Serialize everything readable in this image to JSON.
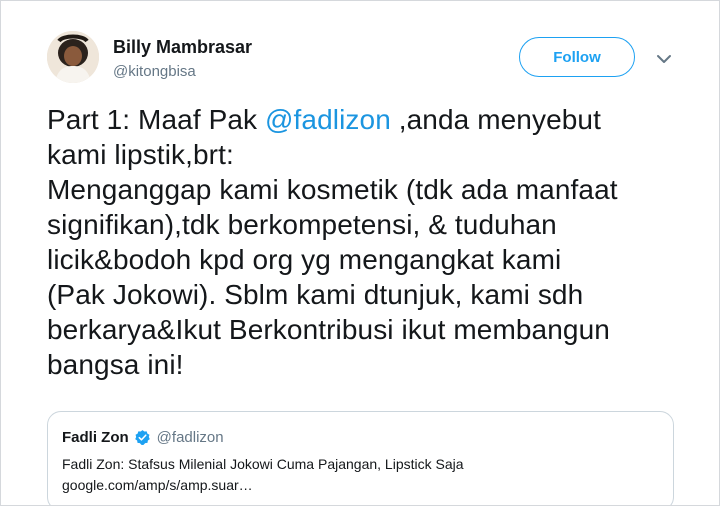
{
  "author": {
    "display_name": "Billy Mambrasar",
    "handle": "@kitongbisa",
    "avatar_icon": "profile-photo"
  },
  "follow_button": {
    "label": "Follow",
    "color": "#1da1f2"
  },
  "menu": {
    "icon": "chevron-down-icon"
  },
  "tweet": {
    "line1_before": "Part 1: Maaf Pak ",
    "mention": "@fadlizon",
    "line1_after": " ,anda menyebut",
    "lines": [
      "kami lipstik,brt:",
      "Menganggap kami kosmetik (tdk ada manfaat",
      "signifikan),tdk berkompetensi, & tuduhan",
      "licik&bodoh kpd org yg mengangkat kami",
      "(Pak Jokowi). Sblm kami dtunjuk, kami sdh",
      "berkarya&Ikut Berkontribusi ikut membangun",
      "bangsa ini!"
    ],
    "mention_color": "#1b95e0"
  },
  "quoted_tweet": {
    "name": "Fadli Zon",
    "verified_icon": "verified-badge-icon",
    "handle": "@fadlizon",
    "text": "Fadli Zon: Stafsus Milenial Jokowi Cuma Pajangan, Lipstick Saja",
    "link": "google.com/amp/s/amp.suar…"
  }
}
